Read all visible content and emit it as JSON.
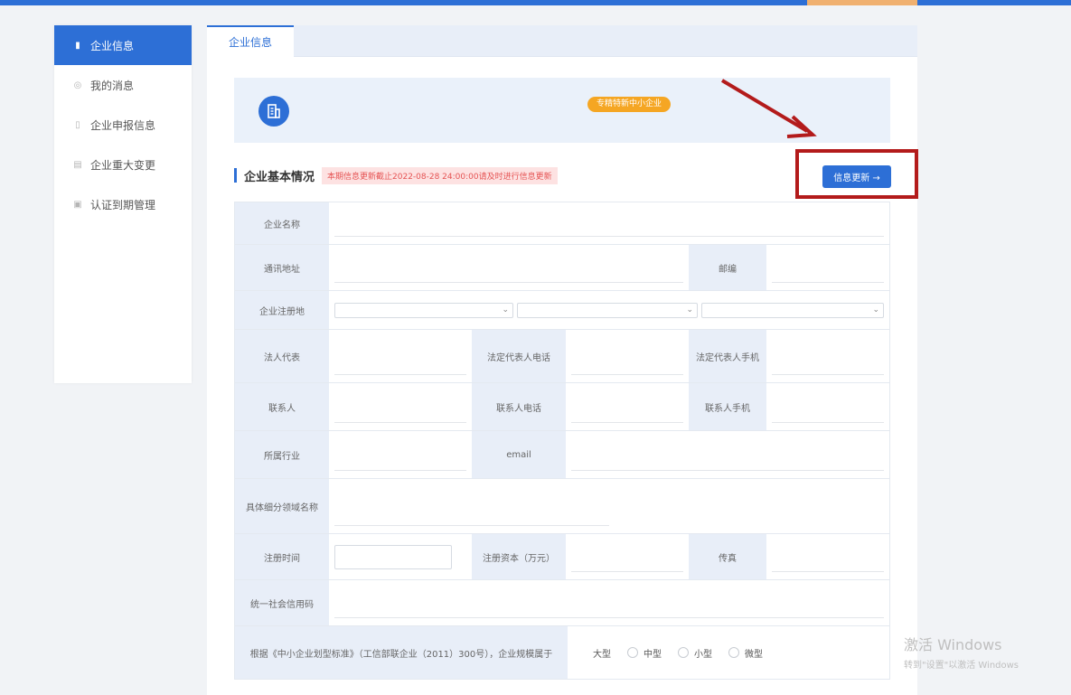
{
  "sidebar": {
    "items": [
      {
        "label": "企业信息",
        "icon": "building-icon"
      },
      {
        "label": "我的消息",
        "icon": "message-icon"
      },
      {
        "label": "企业申报信息",
        "icon": "document-icon"
      },
      {
        "label": "企业重大变更",
        "icon": "list-icon"
      },
      {
        "label": "认证到期管理",
        "icon": "calendar-icon"
      }
    ]
  },
  "tabs": {
    "active": "企业信息"
  },
  "banner": {
    "badge": "专精特新中小企业"
  },
  "section": {
    "title": "企业基本情况",
    "notice": "本期信息更新截止2022-08-28 24:00:00请及时进行信息更新",
    "update_button": "信息更新 →"
  },
  "form": {
    "company_name": "企业名称",
    "address": "通讯地址",
    "postcode": "邮编",
    "reg_place": "企业注册地",
    "legal_rep": "法人代表",
    "legal_rep_phone": "法定代表人电话",
    "legal_rep_mobile": "法定代表人手机",
    "contact": "联系人",
    "contact_phone": "联系人电话",
    "contact_mobile": "联系人手机",
    "industry": "所属行业",
    "email": "email",
    "subfield": "具体细分领域名称",
    "reg_time": "注册时间",
    "reg_capital": "注册资本（万元）",
    "fax": "传真",
    "credit_code": "统一社会信用码",
    "scale_question": "根据《中小企业划型标准》（工信部联企业（2011）300号），企业规模属于",
    "scale_options": [
      "大型",
      "中型",
      "小型",
      "微型"
    ]
  },
  "watermark": {
    "line1": "激活 Windows",
    "line2": "转到\"设置\"以激活 Windows"
  },
  "colors": {
    "primary": "#2d6fd6",
    "badge": "#f5a623",
    "highlight": "#b31b1b",
    "notice_bg": "#fde2e2"
  }
}
